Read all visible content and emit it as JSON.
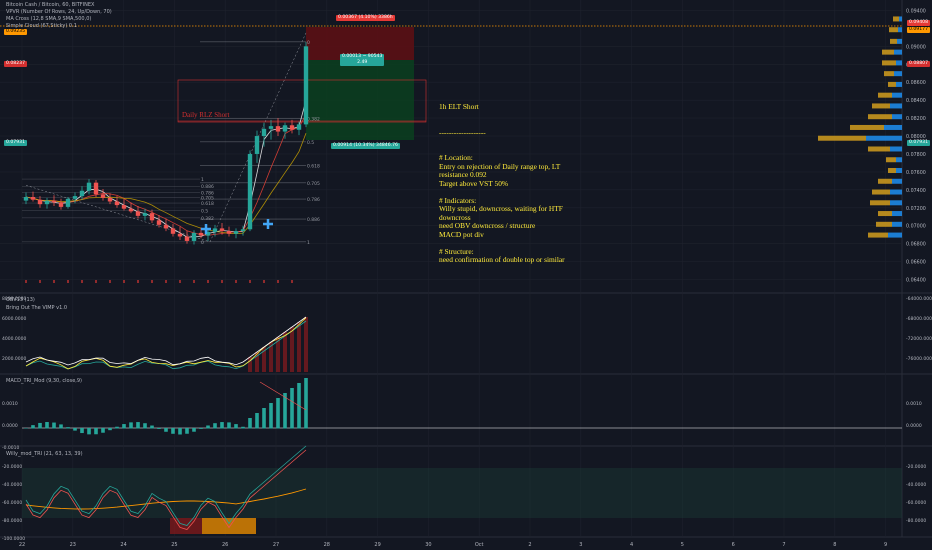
{
  "header": {
    "symbol": "Bitcoin Cash / Bitcoin, 60, BITFINEX",
    "studies": [
      "VPVR (Number Of Rows, 24, Up/Down, 70)",
      "MA Cross (12,8 SMA,9 SMA,500,0)",
      "Simple Cloud (67,Sticky) 0.1"
    ]
  },
  "chart_data": {
    "type": "candlestick",
    "price_axis_labels": [
      "0.09400",
      "0.09000",
      "0.08800",
      "0.08600",
      "0.08400",
      "0.08200",
      "0.08000",
      "0.07800",
      "0.07600",
      "0.07400",
      "0.07200",
      "0.07000",
      "0.06800",
      "0.06600",
      "0.06400"
    ],
    "ylim": [
      0.0635,
      0.0945
    ],
    "x_tick_labels": [
      "22",
      "23",
      "24",
      "25",
      "26",
      "27",
      "28",
      "29",
      "30",
      "Oct",
      "2",
      "3",
      "4",
      "5",
      "6",
      "7",
      "8",
      "9"
    ],
    "ohlc": [
      [
        0.0728,
        0.0737,
        0.0724,
        0.0732
      ],
      [
        0.0732,
        0.0738,
        0.0727,
        0.0729
      ],
      [
        0.0729,
        0.0733,
        0.072,
        0.0724
      ],
      [
        0.0724,
        0.0731,
        0.0719,
        0.0728
      ],
      [
        0.0728,
        0.0734,
        0.0722,
        0.0726
      ],
      [
        0.0726,
        0.073,
        0.0718,
        0.0721
      ],
      [
        0.0721,
        0.0732,
        0.0719,
        0.073
      ],
      [
        0.073,
        0.0737,
        0.0725,
        0.0733
      ],
      [
        0.0733,
        0.0744,
        0.0729,
        0.0739
      ],
      [
        0.0739,
        0.0752,
        0.0735,
        0.0748
      ],
      [
        0.0748,
        0.0751,
        0.0732,
        0.0735
      ],
      [
        0.0735,
        0.0741,
        0.0728,
        0.0731
      ],
      [
        0.0731,
        0.0736,
        0.0724,
        0.0727
      ],
      [
        0.0727,
        0.0733,
        0.072,
        0.0723
      ],
      [
        0.0723,
        0.073,
        0.0717,
        0.0719
      ],
      [
        0.0719,
        0.0726,
        0.0714,
        0.0716
      ],
      [
        0.0716,
        0.0722,
        0.0708,
        0.0711
      ],
      [
        0.0711,
        0.0719,
        0.0706,
        0.0714
      ],
      [
        0.0714,
        0.0718,
        0.0703,
        0.0706
      ],
      [
        0.0706,
        0.0712,
        0.0698,
        0.0701
      ],
      [
        0.0701,
        0.0708,
        0.0694,
        0.0697
      ],
      [
        0.0697,
        0.0702,
        0.0688,
        0.0691
      ],
      [
        0.0691,
        0.0699,
        0.0684,
        0.0688
      ],
      [
        0.0688,
        0.0694,
        0.068,
        0.0683
      ],
      [
        0.0683,
        0.0695,
        0.0679,
        0.0692
      ],
      [
        0.0692,
        0.0698,
        0.0686,
        0.0689
      ],
      [
        0.0689,
        0.0696,
        0.0683,
        0.0693
      ],
      [
        0.0693,
        0.0701,
        0.0688,
        0.0697
      ],
      [
        0.0697,
        0.0703,
        0.069,
        0.0694
      ],
      [
        0.0694,
        0.0699,
        0.0688,
        0.0691
      ],
      [
        0.0691,
        0.0697,
        0.0686,
        0.0694
      ],
      [
        0.0694,
        0.07,
        0.0689,
        0.0696
      ],
      [
        0.0696,
        0.0784,
        0.0694,
        0.078
      ],
      [
        0.078,
        0.0806,
        0.077,
        0.08
      ],
      [
        0.08,
        0.0815,
        0.0788,
        0.0808
      ],
      [
        0.0808,
        0.0818,
        0.0796,
        0.0811
      ],
      [
        0.0811,
        0.082,
        0.08,
        0.0805
      ],
      [
        0.0805,
        0.0815,
        0.0797,
        0.0812
      ],
      [
        0.0812,
        0.0818,
        0.0803,
        0.0807
      ],
      [
        0.0807,
        0.0816,
        0.0801,
        0.0813
      ],
      [
        0.0813,
        0.0905,
        0.081,
        0.09
      ]
    ],
    "fib_labels": [
      "0.886",
      "0.786",
      "0.705",
      "0.618",
      "0.5",
      "0.382",
      "0",
      "1"
    ],
    "trade": {
      "stop_label": "0.00367 (4.10%) 3386h",
      "rr_label": "0.00013 ~ 90543\n2.49",
      "target_label": "0.00914 (10.34%) 34846.76"
    },
    "zone_label": "Daily RLZ Short",
    "indicators": [
      {
        "name": "OBV13 (13)",
        "sub": "Bring Out The VIMP v1.0",
        "axis": [
          "-64000.0000",
          "-68000.0000",
          "-72000.0000",
          "-76000.0000"
        ],
        "left_axis": [
          "8000.0000",
          "6000.0000",
          "4000.0000",
          "2000.0000"
        ]
      },
      {
        "name": "MACD_TRI_Mod (9,30, close,9)",
        "axis": [
          "0.0010",
          "0.0000"
        ],
        "left_axis": [
          "0.0010",
          "0.0000",
          "-0.0010"
        ]
      },
      {
        "name": "Willy_mod_TRI (21, 63, 13, 39)",
        "axis": [
          "-20.0000",
          "-40.0000",
          "-60.0000",
          "-80.0000"
        ],
        "left_axis": [
          "-20.0000",
          "-40.0000",
          "-60.0000",
          "-80.0000",
          "-100.0000"
        ]
      }
    ]
  },
  "note": {
    "title": "1h ELT Short",
    "divider": "-------------------",
    "lines": [
      "# Location:",
      "Entry on rejection of Daily range top, LT",
      "resistance 0.092",
      "Target above VST 50%",
      "",
      "# Indicators:",
      "Willy stupid, downcross, waiting for HTF",
      "downcross",
      "need OBV downcross / structure",
      "MACD pot div",
      "",
      "# Structure:",
      "need confirmation of double top or similar"
    ]
  },
  "price_tags": {
    "right_top": "0.09408",
    "right_2": "0.09177",
    "right_3": "0.08807",
    "left_1": "0.09235",
    "left_2": "0.08237",
    "left_3": "0.07931"
  },
  "colors": {
    "bg": "#131722",
    "up": "#26a69a",
    "down": "#ef5350",
    "note": "#ffeb3b",
    "fib": "#9598a1"
  }
}
